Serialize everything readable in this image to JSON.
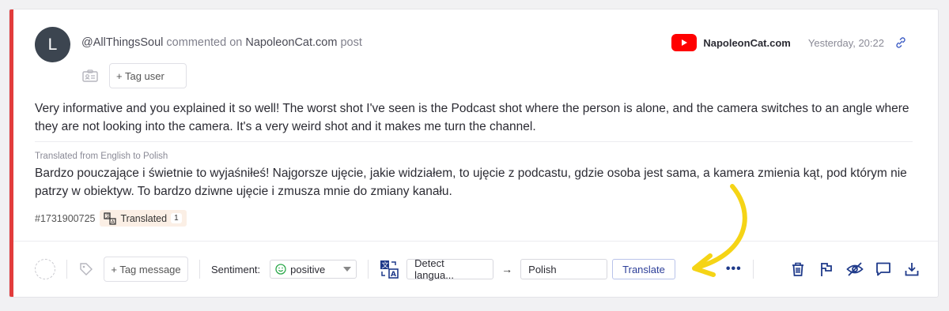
{
  "author": {
    "avatar_letter": "L",
    "handle": "@AllThingsSoul",
    "action": "commented on",
    "target": "NapoleonCat.com",
    "target_suffix": "post"
  },
  "tag_user_label": "+ Tag user",
  "source": {
    "icon": "youtube-icon",
    "name": "NapoleonCat.com",
    "timestamp": "Yesterday, 20:22"
  },
  "comment_text": "Very informative and you explained it so well! The worst shot I've seen is the Podcast shot where the person is alone, and the camera switches to an angle where they are not looking into the camera. It's a very weird shot and it makes me turn the channel.",
  "translation": {
    "label": "Translated from English to Polish",
    "text": "Bardzo pouczające i świetnie to wyjaśniłeś! Najgorsze ujęcie, jakie widziałem, to ujęcie z podcastu, gdzie osoba jest sama, a kamera zmienia kąt, pod którym nie patrzy w obiektyw. To bardzo dziwne ujęcie i zmusza mnie do zmiany kanału."
  },
  "meta": {
    "message_id": "#1731900725",
    "badge_label": "Translated",
    "badge_count": "1"
  },
  "toolbar": {
    "tag_message_label": "+ Tag message",
    "sentiment_label": "Sentiment:",
    "sentiment_value": "positive",
    "source_language": "Detect langua...",
    "target_language": "Polish",
    "translate_label": "Translate",
    "more_label": "•••"
  },
  "colors": {
    "accent": "#e23c3c",
    "primary": "#1f3a8a",
    "highlight_arrow": "#f5d416"
  }
}
